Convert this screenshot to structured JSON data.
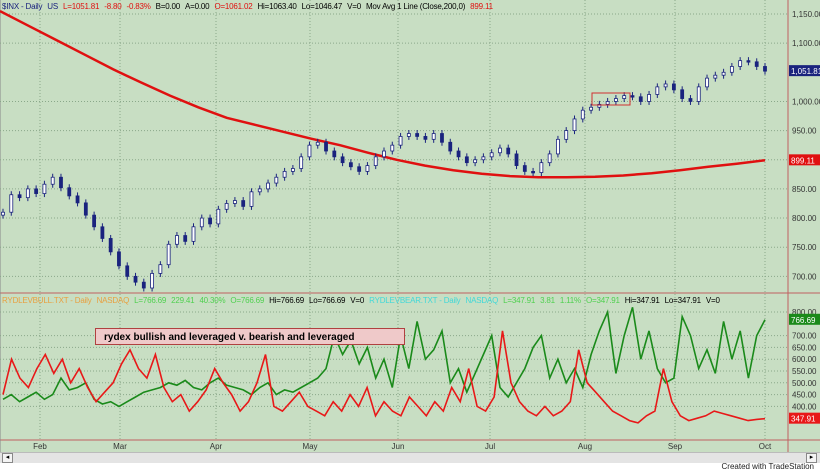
{
  "header_top": {
    "symbol": "$INX - Daily",
    "exchange": "US",
    "last": "L=1051.81",
    "chg": "-8.80",
    "pct": "-0.83%",
    "bid": "B=0.00",
    "ask": "A=0.00",
    "open": "O=1061.02",
    "hi": "Hi=1063.40",
    "lo": "Lo=1046.47",
    "vol": "V=0",
    "study": "Mov Avg 1 Line (Close,200,0)",
    "study_val": "899.11"
  },
  "header_bottom": {
    "s1_symbol": "RYDLEVBULL.TXT - Daily",
    "s1_exchange": "NASDAQ",
    "s1_last": "L=766.69",
    "s1_chg": "229.41",
    "s1_pct": "40.30%",
    "s1_open": "O=766.69",
    "s1_hi": "Hi=766.69",
    "s1_lo": "Lo=766.69",
    "s1_vol": "V=0",
    "s2_symbol": "RYDLEVBEAR.TXT - Daily",
    "s2_exchange": "NASDAQ",
    "s2_last": "L=347.91",
    "s2_chg": "3.81",
    "s2_pct": "1.11%",
    "s2_open": "O=347.91",
    "s2_hi": "Hi=347.91",
    "s2_lo": "Lo=347.91",
    "s2_vol": "V=0"
  },
  "annotation": "rydex bullish and leveraged v. bearish and leveraged",
  "footer": "Created with TradeStation",
  "colors": {
    "bg": "#c8dec3",
    "candle": "#1a237e",
    "ma": "#e01010",
    "bull": "#1a8a1a",
    "bear": "#e81818"
  },
  "chart_data": [
    {
      "type": "candlestick",
      "title": "$INX - Daily",
      "ylim": [
        660,
        1160
      ],
      "yticks": [
        "1,150.00",
        "1,100.00",
        "1,000.00",
        "950.00",
        "900.00",
        "850.00",
        "800.00",
        "750.00",
        "700.00"
      ],
      "ytick_values": [
        1150,
        1100,
        1000,
        950,
        900,
        850,
        800,
        750,
        700
      ],
      "last_label": "1,051.81",
      "ma_label": "899.11",
      "closes": [
        810,
        840,
        835,
        850,
        842,
        858,
        870,
        852,
        838,
        826,
        805,
        785,
        765,
        742,
        718,
        700,
        690,
        680,
        705,
        720,
        755,
        770,
        760,
        785,
        800,
        790,
        815,
        825,
        830,
        820,
        845,
        850,
        860,
        870,
        880,
        885,
        905,
        925,
        930,
        915,
        905,
        895,
        888,
        880,
        890,
        905,
        915,
        925,
        940,
        945,
        940,
        935,
        945,
        930,
        915,
        905,
        895,
        900,
        905,
        912,
        920,
        910,
        890,
        880,
        878,
        895,
        910,
        935,
        950,
        970,
        985,
        990,
        995,
        1000,
        1005,
        1010,
        1008,
        1000,
        1012,
        1025,
        1030,
        1020,
        1005,
        1000,
        1025,
        1040,
        1045,
        1050,
        1060,
        1070,
        1068,
        1060,
        1052
      ],
      "ma200": [
        1155,
        1130,
        1105,
        1080,
        1055,
        1032,
        1010,
        990,
        972,
        960,
        948,
        936,
        925,
        912,
        900,
        890,
        882,
        876,
        872,
        870,
        870,
        871,
        873,
        877,
        882,
        888,
        893,
        899
      ]
    },
    {
      "type": "line",
      "ylim": [
        300,
        820
      ],
      "yticks": [
        "800.00",
        "700.00",
        "650.00",
        "600.00",
        "550.00",
        "500.00",
        "450.00",
        "400.00"
      ],
      "ytick_values": [
        800,
        700,
        650,
        600,
        550,
        500,
        450,
        400
      ],
      "series": [
        {
          "name": "RYDLEVBULL",
          "last_label": "766.69",
          "values": [
            430,
            450,
            420,
            440,
            460,
            430,
            450,
            520,
            470,
            480,
            500,
            430,
            410,
            420,
            400,
            420,
            440,
            460,
            470,
            480,
            500,
            490,
            510,
            480,
            470,
            500,
            520,
            490,
            480,
            470,
            450,
            480,
            500,
            450,
            470,
            460,
            480,
            500,
            520,
            560,
            700,
            620,
            680,
            580,
            650,
            520,
            600,
            480,
            700,
            560,
            760,
            600,
            640,
            720,
            500,
            560,
            460,
            540,
            620,
            700,
            480,
            440,
            500,
            560,
            650,
            700,
            520,
            600,
            500,
            560,
            480,
            620,
            720,
            800,
            540,
            700,
            820,
            600,
            720,
            560,
            500,
            520,
            780,
            700,
            560,
            640,
            540,
            760,
            600,
            720,
            520,
            700,
            767
          ]
        },
        {
          "name": "RYDLEVBEAR",
          "last_label": "347.91",
          "values": [
            450,
            600,
            520,
            480,
            560,
            620,
            540,
            600,
            500,
            560,
            480,
            420,
            460,
            500,
            580,
            640,
            560,
            520,
            620,
            480,
            420,
            450,
            380,
            420,
            470,
            560,
            500,
            450,
            380,
            420,
            500,
            620,
            400,
            380,
            420,
            460,
            400,
            380,
            360,
            420,
            380,
            450,
            400,
            480,
            360,
            420,
            380,
            360,
            440,
            400,
            360,
            420,
            380,
            480,
            420,
            560,
            400,
            380,
            440,
            720,
            500,
            420,
            380,
            360,
            400,
            360,
            380,
            420,
            640,
            500,
            460,
            420,
            380,
            360,
            340,
            330,
            360,
            380,
            560,
            420,
            360,
            340,
            350,
            360,
            380,
            370,
            360,
            350,
            340,
            345,
            348
          ]
        }
      ]
    },
    {
      "type": "axis",
      "xticks": [
        "Feb",
        "Mar",
        "Apr",
        "May",
        "Jun",
        "Jul",
        "Aug",
        "Sep",
        "Oct"
      ]
    }
  ]
}
